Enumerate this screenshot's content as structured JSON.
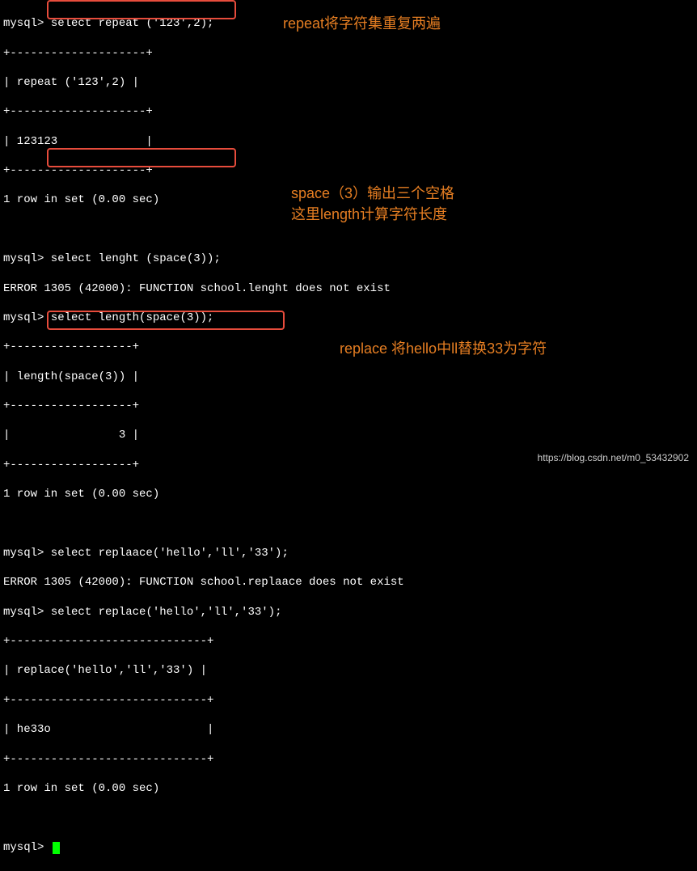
{
  "terminal": {
    "block1": {
      "prompt": "mysql>",
      "cmd": " select repeat ('123',2);",
      "sep": "+--------------------+",
      "header": "| repeat ('123',2) |",
      "row": "| 123123             |",
      "footer": "1 row in set (0.00 sec)"
    },
    "block2": {
      "line1": "mysql> select lenght (space(3));",
      "error": "ERROR 1305 (42000): FUNCTION school.lenght does not exist",
      "prompt": "mysql>",
      "cmd": " select length(space(3));",
      "sep": "+------------------+",
      "header": "| length(space(3)) |",
      "row": "|                3 |",
      "footer": "1 row in set (0.00 sec)"
    },
    "block3": {
      "line1": "mysql> select replaace('hello','ll','33');",
      "error": "ERROR 1305 (42000): FUNCTION school.replaace does not exist",
      "prompt": "mysql>",
      "cmd": " select replace('hello','ll','33');",
      "sep": "+-----------------------------+",
      "header": "| replace('hello','ll','33') |",
      "row": "| he33o                       |",
      "footer": "1 row in set (0.00 sec)"
    },
    "finalprompt": "mysql> "
  },
  "annotations": {
    "a1": "repeat将字符集重复两遍",
    "a2_line1": "space（3）输出三个空格",
    "a2_line2": "这里length计算字符长度",
    "a3": "replace 将hello中ll替换33为字符"
  },
  "watermark": "https://blog.csdn.net/m0_53432902"
}
